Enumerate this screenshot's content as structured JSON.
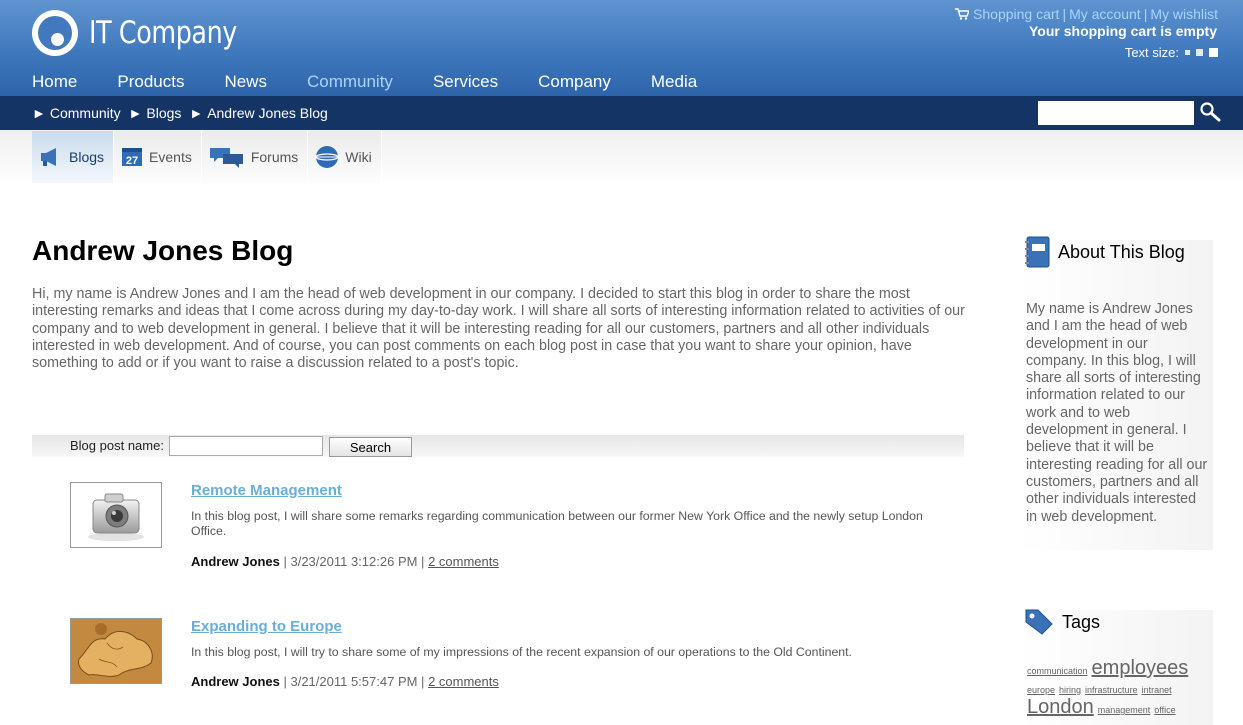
{
  "header": {
    "logo_text": "IT Company",
    "top_links": [
      "Shopping cart",
      "My account",
      "My wishlist"
    ],
    "cart_status": "Your shopping cart is empty",
    "text_size_label": "Text size:"
  },
  "main_nav": [
    "Home",
    "Products",
    "News",
    "Community",
    "Services",
    "Company",
    "Media"
  ],
  "main_nav_active": "Community",
  "breadcrumb": [
    "Community",
    "Blogs",
    "Andrew Jones Blog"
  ],
  "search": {
    "placeholder": "",
    "value": ""
  },
  "sub_nav": [
    {
      "label": "Blogs",
      "icon": "megaphone-icon",
      "active": true
    },
    {
      "label": "Events",
      "icon": "calendar-icon",
      "day": "27"
    },
    {
      "label": "Forums",
      "icon": "chat-bubbles-icon"
    },
    {
      "label": "Wiki",
      "icon": "globe-icon"
    }
  ],
  "blog": {
    "title": "Andrew Jones Blog",
    "intro": "Hi, my name is Andrew Jones and I am the head of web development in our company. I decided to start this blog in order to share the most interesting remarks and ideas that I come across during my day-to-day work. I will share all sorts of interesting information related to activities of our company and to web development in general. I believe that it will be interesting reading for all our customers, partners and all other individuals interested in web development. And of course, you can post comments on each blog post in case that you want to share your opinion, have something to add or if you want to raise a discussion related to a post's topic.",
    "search_label": "Blog post name:",
    "search_button": "Search",
    "search_value": ""
  },
  "posts": [
    {
      "title": "Remote Management",
      "summary": "In this blog post, I will share some remarks regarding communication between our former New York Office and the newly setup London Office.",
      "author": "Andrew Jones",
      "date": "| 3/23/2011 3:12:26 PM |",
      "comments": "2 comments",
      "thumb": "camera-image"
    },
    {
      "title": "Expanding to Europe",
      "summary": "In this blog post, I will try to share some of my impressions of the recent expansion of our operations to the Old Continent.",
      "author": "Andrew Jones",
      "date": "| 3/21/2011 5:57:47 PM |",
      "comments": "2 comments",
      "thumb": "europe-map-image"
    }
  ],
  "sidebar": {
    "about_title": "About This Blog",
    "about_text": "My name is Andrew Jones and I am the head of web development in our company. In this blog, I will share all sorts of interesting information related to our work and to web development in general. I believe that it will be interesting reading for all our customers, partners and all other individuals interested in web development.",
    "tags_title": "Tags",
    "tags": [
      {
        "label": "communication",
        "size": "s"
      },
      {
        "label": "employees",
        "size": "l"
      },
      {
        "label": "europe",
        "size": "s"
      },
      {
        "label": "hiring",
        "size": "s"
      },
      {
        "label": "infrastructure",
        "size": "s"
      },
      {
        "label": "intranet",
        "size": "s"
      },
      {
        "label": "London",
        "size": "l"
      },
      {
        "label": "management",
        "size": "s"
      },
      {
        "label": "office",
        "size": "s"
      }
    ]
  },
  "colors": {
    "header_blue": "#3f78bd",
    "crumb_bar": "#153466",
    "link_blue": "#6aaed8",
    "active_nav": "#a8d4ff"
  }
}
